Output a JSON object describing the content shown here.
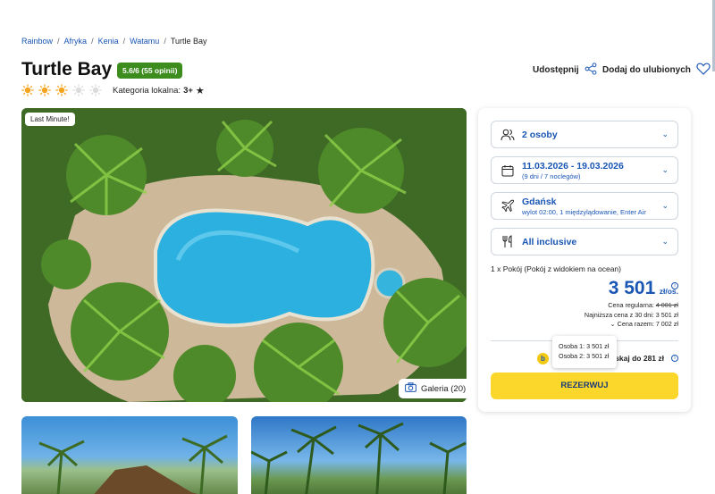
{
  "breadcrumb": {
    "items": [
      "Rainbow",
      "Afryka",
      "Kenia",
      "Watamu"
    ],
    "current": "Turtle Bay",
    "separator": "/"
  },
  "hotel": {
    "name": "Turtle Bay",
    "rating_badge": "5.6/6 (55 opinii)",
    "suns_total": 5,
    "suns_filled": 3,
    "category_label": "Kategoria lokalna:",
    "category_value": "3+"
  },
  "actions": {
    "share_label": "Udostępnij",
    "favorite_label": "Dodaj do ulubionych"
  },
  "gallery": {
    "badge": "Last Minute!",
    "button_label": "Galeria (20)"
  },
  "booking": {
    "persons": "2 osoby",
    "dates": "11.03.2026 - 19.03.2026",
    "dates_sub": "(9 dni / 7 noclegów)",
    "departure": "Gdańsk",
    "departure_sub": "wylot 02:00, 1 międzylądowanie, Enter Air",
    "board": "All inclusive",
    "room": "1 x Pokój  (Pokój z widokiem na ocean)",
    "price": "3 501",
    "price_unit": "zł/os.",
    "regular_label": "Cena regularna:",
    "regular_value": "4 001 zł",
    "lowest_label": "Najniższa cena z 30 dni: 3 501 zł",
    "total_label": "Cena razem: 7 002 zł",
    "discount_text": "skaj do 281 zł",
    "tooltip_line1": "Osoba 1: 3 501 zł",
    "tooltip_line2": "Osoba 2: 3 501 zł",
    "reserve_label": "REZERWUJ"
  },
  "colors": {
    "brand_blue": "#1a56b4",
    "rating_green": "#3c8c1e",
    "reserve_yellow": "#fcd72b",
    "sun_orange": "#f4a41c"
  }
}
